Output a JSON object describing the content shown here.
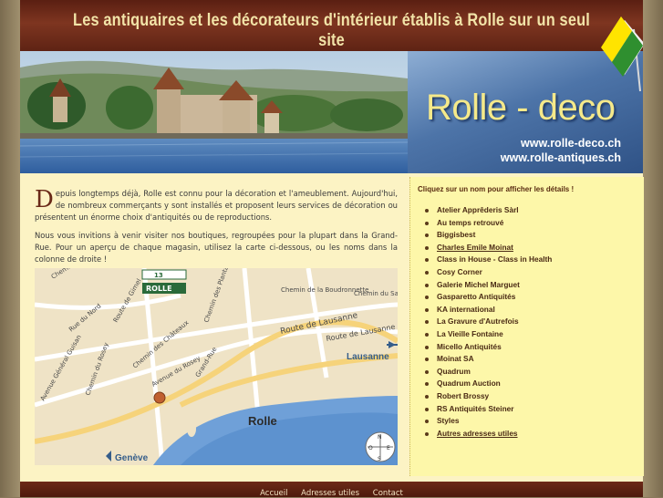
{
  "header": {
    "title": "Les antiquaires et les décorateurs d'intérieur établis à Rolle sur un seul site"
  },
  "brand": {
    "name": "Rolle - deco",
    "url1": "www.rolle-deco.ch",
    "url2": "www.rolle-antiques.ch"
  },
  "intro": {
    "dropcap": "D",
    "text": "epuis longtemps déjà, Rolle est connu pour la décoration et l'ameublement. Aujourd'hui, de nombreux commerçants y sont installés et proposent leurs services de décoration ou présentent un énorme choix d'antiquités ou de reproductions.",
    "para2": "Nous vous invitions à venir visiter nos boutiques, regroupées pour la plupart dans la Grand-Rue. Pour un aperçu de chaque magasin, utilisez la carte ci-dessous, ou les noms dans la colonne de droite !"
  },
  "map": {
    "sign_number": "13",
    "sign_label": "ROLLE",
    "town_label": "Rolle",
    "lausanne_label": "Lausanne",
    "geneve_label": "Genève",
    "street_labels": [
      "Chemin de la Boverie",
      "Chemin de la Boudronnette",
      "Chemin du Sauvage",
      "Route de Lausanne",
      "Route de Lausanne",
      "Grand-Rue",
      "Route de Gimel",
      "Avenue Général Guisan",
      "Chemin des Plantaz",
      "Rue du Nord",
      "Chemin du Rosey",
      "Chemin des Châteaux",
      "Avenue du Rosey"
    ],
    "compass": [
      "N",
      "E",
      "S",
      "O"
    ]
  },
  "sidebar": {
    "heading": "Cliquez sur un nom pour afficher les détails !",
    "items": [
      {
        "label": "Atelier Apprêderis Sàrl",
        "underline": false
      },
      {
        "label": "Au temps retrouvé",
        "underline": false
      },
      {
        "label": "Biggisbest",
        "underline": false
      },
      {
        "label": "Charles Emile Moinat",
        "underline": true
      },
      {
        "label": "Class in House - Class in Health",
        "underline": false
      },
      {
        "label": "Cosy Corner",
        "underline": false
      },
      {
        "label": "Galerie Michel Marguet",
        "underline": false
      },
      {
        "label": "Gasparetto Antiquités",
        "underline": false
      },
      {
        "label": "KA international",
        "underline": false
      },
      {
        "label": "La Gravure d'Autrefois",
        "underline": false
      },
      {
        "label": "La Vieille Fontaine",
        "underline": false
      },
      {
        "label": "Micello Antiquités",
        "underline": false
      },
      {
        "label": "Moinat SA",
        "underline": false
      },
      {
        "label": "Quadrum",
        "underline": false
      },
      {
        "label": "Quadrum Auction",
        "underline": false
      },
      {
        "label": "Robert Brossy",
        "underline": false
      },
      {
        "label": "RS Antiquités Steiner",
        "underline": false
      },
      {
        "label": "Styles",
        "underline": false
      },
      {
        "label": "Autres adresses utiles",
        "underline": true
      }
    ]
  },
  "footer": {
    "links": [
      "Accueil",
      "Adresses utiles",
      "Contact"
    ]
  }
}
